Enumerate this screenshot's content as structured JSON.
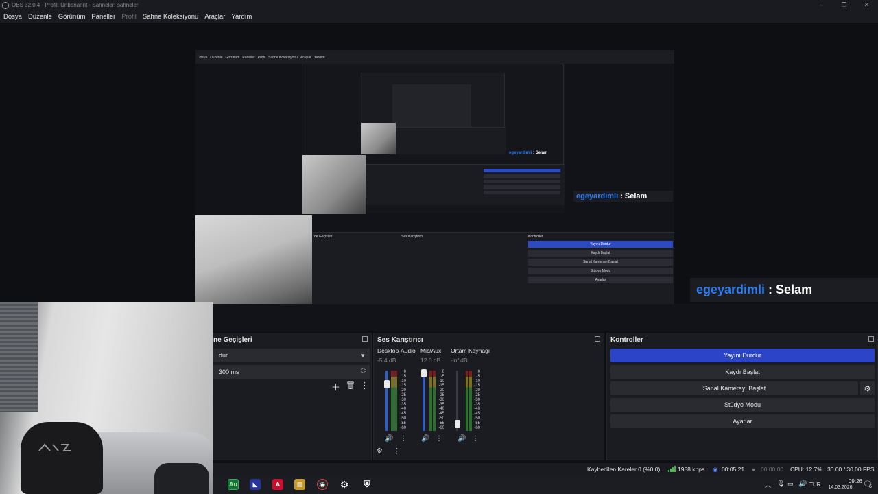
{
  "window": {
    "title": "OBS 32.0.4 - Profil: Unbenannt - Sahneler: sahneler",
    "controls": [
      "–",
      "❐",
      "✕"
    ]
  },
  "menu": {
    "items": [
      "Dosya",
      "Düzenle",
      "Görünüm",
      "Paneller",
      "Profil",
      "Sahne Koleksiyonu",
      "Araçlar",
      "Yardım"
    ]
  },
  "overlay": {
    "chat_name": "egeyardimli",
    "chat_sep": " : ",
    "chat_msg": "Selam"
  },
  "scene_transitions": {
    "title": "ne Geçişleri",
    "transition_value": "dur",
    "duration_value": "300 ms"
  },
  "mixer": {
    "title": "Ses Karıştırıcı",
    "channels": [
      {
        "name": "Desktop-Audio",
        "db": "-5.4 dB"
      },
      {
        "name": "Mic/Aux",
        "db": "12.0 dB"
      },
      {
        "name": "Ortam Kaynağı",
        "db": "-inf dB"
      }
    ],
    "scale": [
      "0",
      "-5",
      "-10",
      "-15",
      "-20",
      "-25",
      "-30",
      "-35",
      "-40",
      "-45",
      "-50",
      "-55",
      "-60"
    ]
  },
  "controls": {
    "title": "Kontroller",
    "stop_stream": "Yayını Durdur",
    "start_record": "Kaydı Başlat",
    "start_virtualcam": "Sanal Kamerayı Başlat",
    "studio_mode": "Stüdyo Modu",
    "settings": "Ayarlar"
  },
  "status": {
    "dropped": "Kaybedilen Kareler 0 (%0.0)",
    "bitrate": "1958 kbps",
    "stream_time": "00:05:21",
    "record_time": "00:00:00",
    "cpu": "CPU: 12.7%",
    "fps": "30.00 / 30.00 FPS"
  },
  "taskbar": {
    "lang": "TUR",
    "time": "09:26",
    "date": "14.03.2026",
    "notif": "6",
    "au_label": "Au",
    "a_label": "A"
  },
  "colors": {
    "accent_blue": "#2c45c8",
    "chat_name": "#2e7df0",
    "meter_green": "#2e6e2e"
  }
}
